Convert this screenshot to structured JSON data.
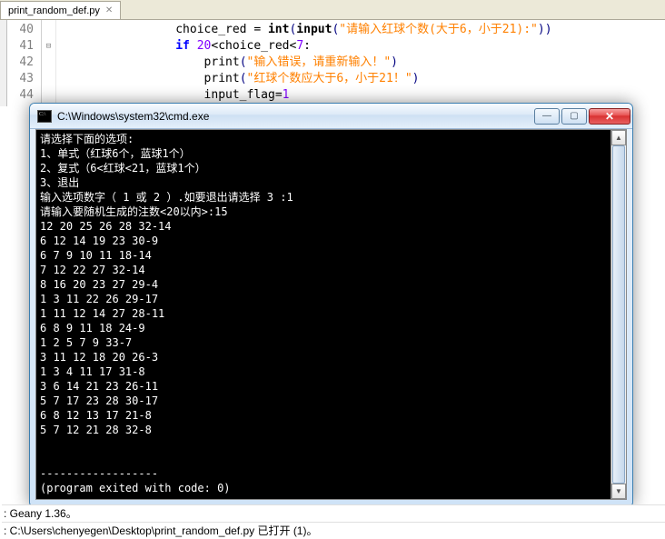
{
  "tab": {
    "filename": "print_random_def.py"
  },
  "editor": {
    "lines": [
      "40",
      "41",
      "42",
      "43",
      "44"
    ],
    "l40": {
      "ind": "                ",
      "v": "choice_red ",
      "eq": "=",
      "sp": " ",
      "fn1": "int",
      "p1": "(",
      "fn2": "input",
      "p2": "(",
      "s": "\"请输入红球个数(大于6，小于21):\"",
      "p3": ")",
      "p4": ")"
    },
    "l41": {
      "ind": "                ",
      "kw": "if ",
      "n1": "20",
      "op1": "<",
      "v": "choice_red",
      "op2": "<",
      "n2": "7",
      "c": ":"
    },
    "l42": {
      "ind": "                    ",
      "fn": "print",
      "p1": "(",
      "s": "\"输入错误，请重新输入！\"",
      "p2": ")"
    },
    "l43": {
      "ind": "                    ",
      "fn": "print",
      "p1": "(",
      "s": "\"红球个数应大于6，小于21！\"",
      "p2": ")"
    },
    "l44": {
      "ind": "                    ",
      "v": "input_flag",
      "eq": "=",
      "n": "1"
    }
  },
  "cmd": {
    "title": "C:\\Windows\\system32\\cmd.exe",
    "body": "请选择下面的选项:\n1、单式（红球6个，蓝球1个）\n2、复式（6<红球<21，蓝球1个）\n3、退出\n输入选项数字（ 1 或 2 ）.如要退出请选择 3 :1\n请输入要随机生成的注数<20以内>:15\n12 20 25 26 28 32-14\n6 12 14 19 23 30-9\n6 7 9 10 11 18-14\n7 12 22 27 32-14\n8 16 20 23 27 29-4\n1 3 11 22 26 29-17\n1 11 12 14 27 28-11\n6 8 9 11 18 24-9\n1 2 5 7 9 33-7\n3 11 12 18 20 26-3\n1 3 4 11 17 31-8\n3 6 14 21 23 26-11\n5 7 17 23 28 30-17\n6 8 12 13 17 21-8\n5 7 12 21 28 32-8\n\n\n------------------\n(program exited with code: 0)"
  },
  "status": {
    "line1": ": Geany 1.36。",
    "line2": ": C:\\Users\\chenyegen\\Desktop\\print_random_def.py 已打开 (1)。"
  }
}
